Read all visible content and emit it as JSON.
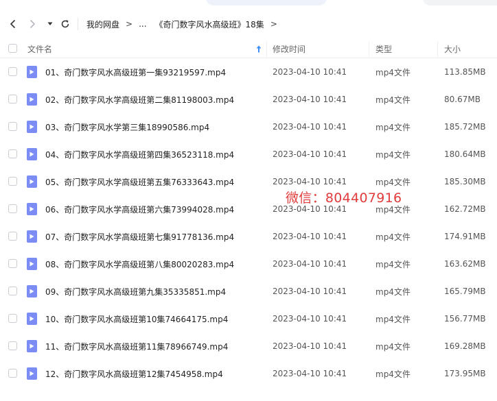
{
  "navigation": {
    "back_icon": "chevron-left-icon",
    "forward_icon": "chevron-right-icon",
    "history_icon": "caret-down-icon",
    "refresh_icon": "refresh-icon"
  },
  "breadcrumb": {
    "root": "我的网盘",
    "ellipsis": "...",
    "current": "《奇门数字风水高级班》18集",
    "separator": ">"
  },
  "table": {
    "columns": {
      "name": "文件名",
      "modified": "修改时间",
      "type": "类型",
      "size": "大小"
    },
    "sort_icon": "arrow-up-icon",
    "rows": [
      {
        "name": "01、奇门数字风水高级班第一集93219597.mp4",
        "modified": "2023-04-10 10:41",
        "type": "mp4文件",
        "size": "113.85MB"
      },
      {
        "name": "02、奇门数字风水学高级班第二集81198003.mp4",
        "modified": "2023-04-10 10:41",
        "type": "mp4文件",
        "size": "80.67MB"
      },
      {
        "name": "03、奇门数字风水学第三集18990586.mp4",
        "modified": "2023-04-10 10:41",
        "type": "mp4文件",
        "size": "185.72MB"
      },
      {
        "name": "04、奇门数字风水学高级班第四集36523118.mp4",
        "modified": "2023-04-10 10:41",
        "type": "mp4文件",
        "size": "180.64MB"
      },
      {
        "name": "05、奇门数字风水学高级班第五集76333643.mp4",
        "modified": "2023-04-10 10:41",
        "type": "mp4文件",
        "size": "185.30MB"
      },
      {
        "name": "06、奇门数字风水学高级班第六集73994028.mp4",
        "modified": "2023-04-10 10:41",
        "type": "mp4文件",
        "size": "162.72MB"
      },
      {
        "name": "07、奇门数字风水学高级班第七集91778136.mp4",
        "modified": "2023-04-10 10:41",
        "type": "mp4文件",
        "size": "174.91MB"
      },
      {
        "name": "08、奇门数字风水学高级班第八集80020283.mp4",
        "modified": "2023-04-10 10:41",
        "type": "mp4文件",
        "size": "163.62MB"
      },
      {
        "name": "09、奇门数字风水高级班第九集35335851.mp4",
        "modified": "2023-04-10 10:41",
        "type": "mp4文件",
        "size": "165.79MB"
      },
      {
        "name": "10、奇门数字风水高级班第10集74664175.mp4",
        "modified": "2023-04-10 10:41",
        "type": "mp4文件",
        "size": "156.77MB"
      },
      {
        "name": "11、奇门数字风水高级班第11集78966749.mp4",
        "modified": "2023-04-10 10:41",
        "type": "mp4文件",
        "size": "169.28MB"
      },
      {
        "name": "12、奇门数字风水高级班第12集7454958.mp4",
        "modified": "2023-04-10 10:41",
        "type": "mp4文件",
        "size": "173.95MB"
      }
    ]
  },
  "watermark": {
    "text": "微信：804407916",
    "color": "#e23b3b"
  },
  "colors": {
    "file_icon": "#7b8cf5",
    "sort_accent": "#3b8ef5"
  }
}
